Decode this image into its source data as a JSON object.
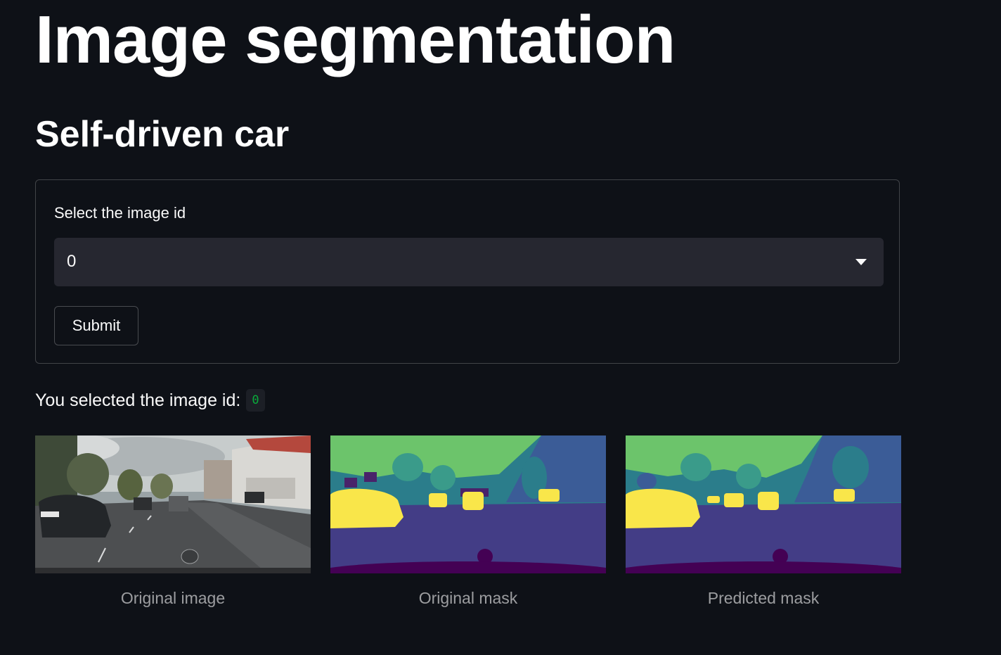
{
  "page": {
    "title": "Image segmentation",
    "subtitle": "Self-driven car"
  },
  "form": {
    "select_label": "Select the image id",
    "selected_value": "0",
    "submit_label": "Submit"
  },
  "result": {
    "text": "You selected the image id:",
    "value": "0"
  },
  "images": [
    {
      "caption": "Original image"
    },
    {
      "caption": "Original mask"
    },
    {
      "caption": "Predicted mask"
    }
  ],
  "colors": {
    "background": "#0e1117",
    "select_bg": "#262730",
    "code_green": "#09ab3b",
    "mask_purple": "#433d86",
    "mask_teal": "#2b7d8b",
    "mask_green": "#6cc46b",
    "mask_yellow": "#f9e64a",
    "mask_blue": "#3b5c97"
  }
}
